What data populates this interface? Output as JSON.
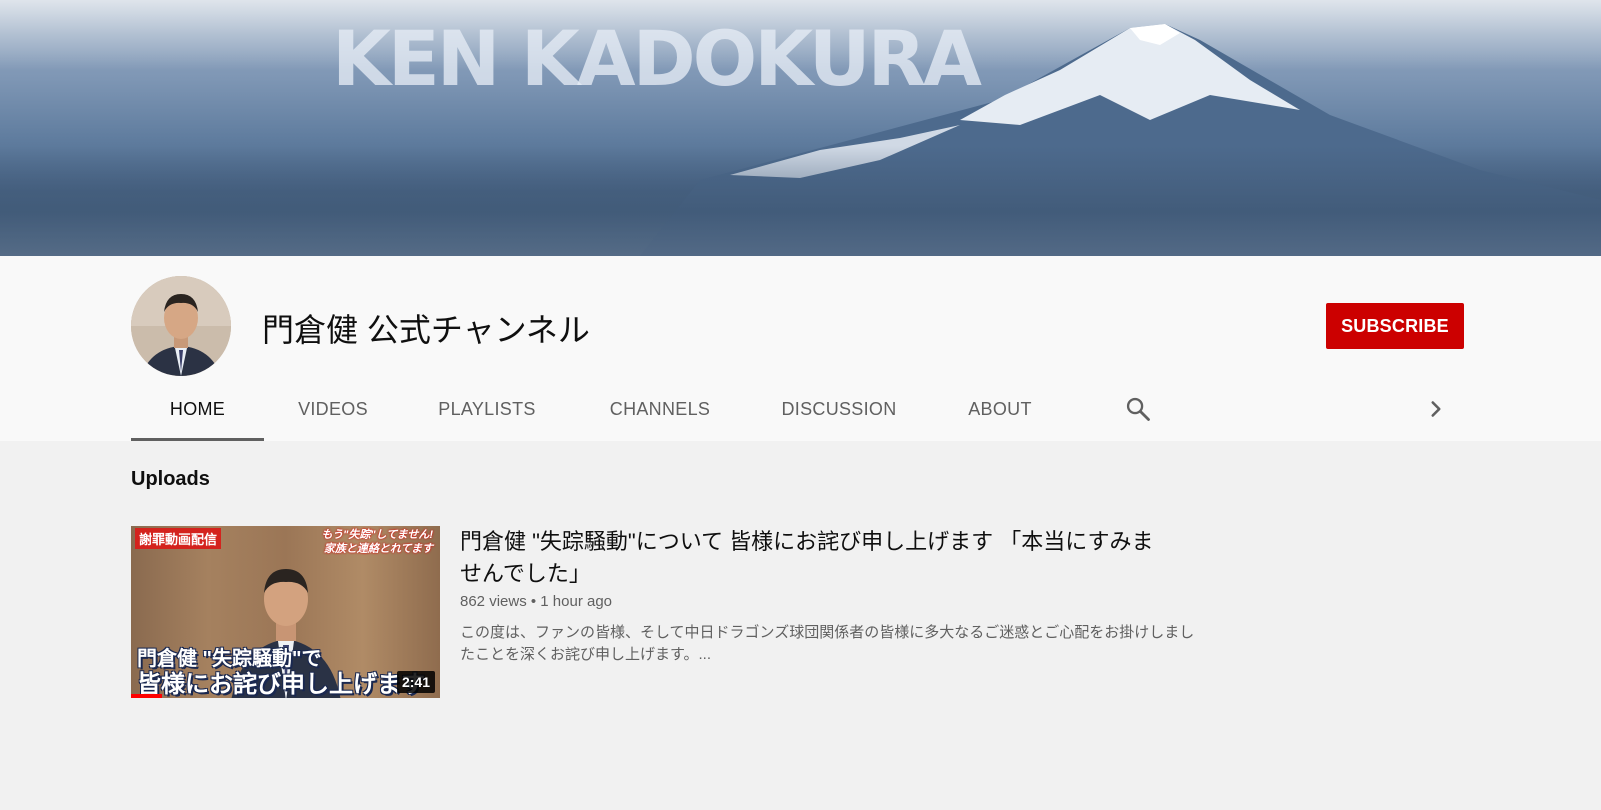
{
  "banner": {
    "title": "KEN KADOKURA"
  },
  "channel": {
    "name": "門倉健 公式チャンネル",
    "subscribe_label": "SUBSCRIBE"
  },
  "tabs": [
    {
      "label": "HOME",
      "active": true
    },
    {
      "label": "VIDEOS",
      "active": false
    },
    {
      "label": "PLAYLISTS",
      "active": false
    },
    {
      "label": "CHANNELS",
      "active": false
    },
    {
      "label": "DISCUSSION",
      "active": false
    },
    {
      "label": "ABOUT",
      "active": false
    }
  ],
  "icons": {
    "search": "search-icon",
    "next": "chevron-right-icon"
  },
  "uploads": {
    "section_title": "Uploads",
    "video": {
      "title": "門倉健 \"失踪騒動\"について 皆様にお詫び申し上げます 「本当にすみませんでした」",
      "views": "862 views",
      "age": "1 hour ago",
      "description": "この度は、ファンの皆様、そして中日ドラゴンズ球団関係者の皆様に多大なるご迷惑とご心配をお掛けしましたことを深くお詫び申し上げます。...",
      "duration": "2:41",
      "watched_fraction": 0.1,
      "thumbnail": {
        "tag": "謝罪動画配信",
        "tag2_line1": "もう\"失踪\"してません!",
        "tag2_line2": "家族と連絡とれてます",
        "caption1": "門倉健 \"失踪騒動\"で",
        "caption2": "皆様にお詫び申し上げます"
      }
    }
  },
  "colors": {
    "subscribe": "#cc0000",
    "header_bg": "#f9f9f9",
    "page_bg": "#f1f1f1",
    "progress": "#ff0000"
  }
}
